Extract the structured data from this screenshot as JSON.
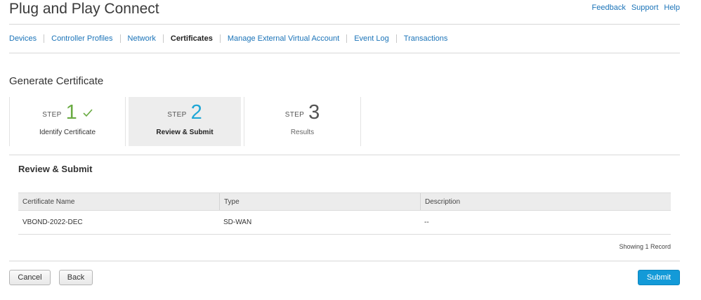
{
  "app": {
    "title": "Plug and Play Connect"
  },
  "top_links": [
    "Feedback",
    "Support",
    "Help"
  ],
  "nav": {
    "tabs": [
      {
        "label": "Devices",
        "active": false
      },
      {
        "label": "Controller Profiles",
        "active": false
      },
      {
        "label": "Network",
        "active": false
      },
      {
        "label": "Certificates",
        "active": true
      },
      {
        "label": "Manage External Virtual Account",
        "active": false
      },
      {
        "label": "Event Log",
        "active": false
      },
      {
        "label": "Transactions",
        "active": false
      }
    ]
  },
  "page": {
    "title": "Generate Certificate"
  },
  "wizard": {
    "step_word": "STEP",
    "steps": [
      {
        "number": "1",
        "caption": "Identify Certificate",
        "state": "completed"
      },
      {
        "number": "2",
        "caption": "Review & Submit",
        "state": "current"
      },
      {
        "number": "3",
        "caption": "Results",
        "state": "pending"
      }
    ]
  },
  "review": {
    "title": "Review & Submit",
    "columns": [
      "Certificate Name",
      "Type",
      "Description"
    ],
    "rows": [
      [
        "VBOND-2022-DEC",
        "SD-WAN",
        "--"
      ]
    ],
    "record_count": "Showing 1 Record"
  },
  "buttons": {
    "cancel": "Cancel",
    "back": "Back",
    "submit": "Submit"
  },
  "colors": {
    "link": "#1a73b8",
    "step_done": "#6aab43",
    "step_current": "#1fa7d6",
    "primary": "#139ad8"
  },
  "icons": {
    "completed_step": "checkmark-icon"
  }
}
